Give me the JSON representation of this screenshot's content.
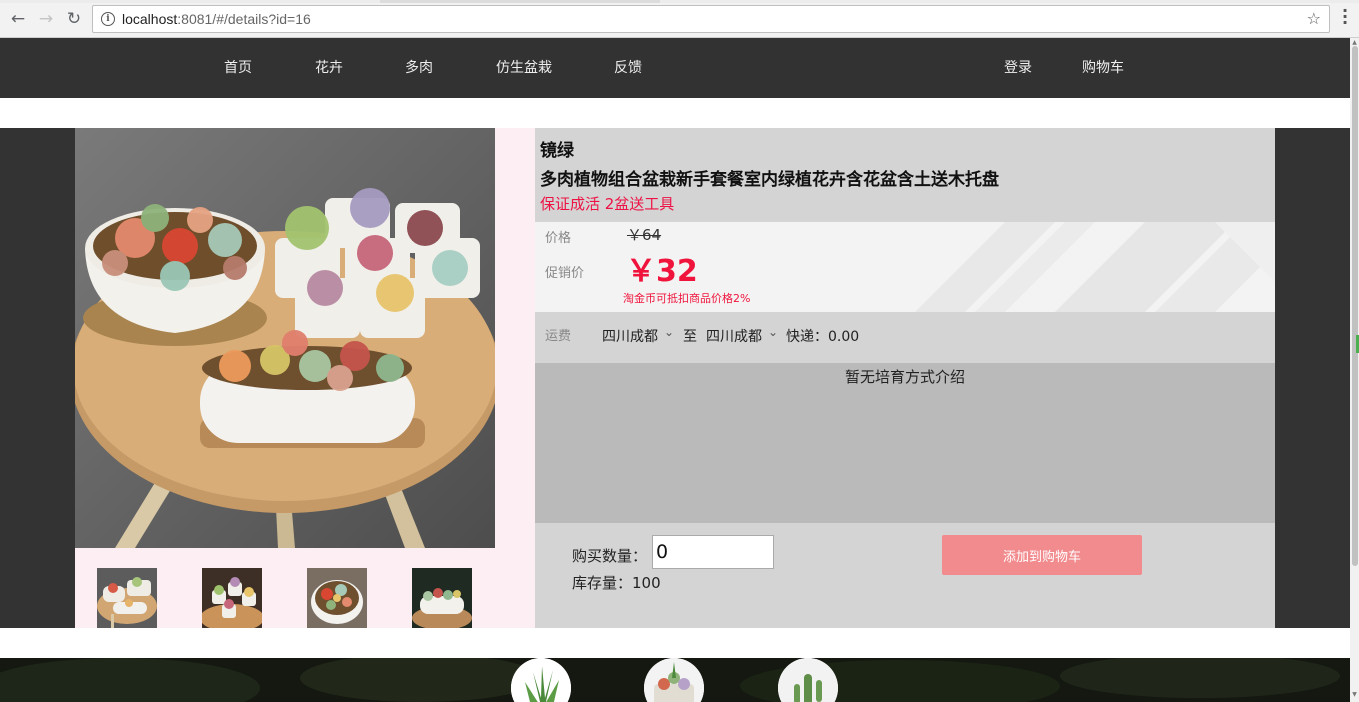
{
  "browser": {
    "url_host": "localhost",
    "url_rest": ":8081/#/details?id=16"
  },
  "header": {
    "nav": [
      "首页",
      "花卉",
      "多肉",
      "仿生盆栽",
      "反馈"
    ],
    "login": "登录",
    "cart": "购物车"
  },
  "product": {
    "title": "镜绿",
    "subtitle": "多肉植物组合盆栽新手套餐室内绿植花卉含花盆含土送木托盘",
    "slogan": "保证成活 2盆送工具",
    "price_label": "价格",
    "old_price": "￥64",
    "sale_label": "促销价",
    "sale_price": "￥32",
    "coin_note": "淘金币可抵扣商品价格2%",
    "shipping_label": "运费",
    "ship_from": "四川成都",
    "ship_to_word": "至",
    "ship_to": "四川成都",
    "express": "快递：0.00",
    "care_text": "暂无培育方式介绍",
    "qty_label": "购买数量：",
    "qty_value": "0",
    "stock": "库存量：100",
    "add_to_cart": "添加到购物车"
  },
  "colors": {
    "header_bg": "#323232",
    "accent_red": "#f0143c",
    "cart_button": "#f28b8e",
    "info_bg": "#d4d4d4",
    "gallery_bg": "#fdeef3"
  },
  "icons": [
    "back-icon",
    "forward-icon",
    "reload-icon",
    "info-icon",
    "star-icon",
    "menu-icon",
    "chevron-down-icon"
  ]
}
